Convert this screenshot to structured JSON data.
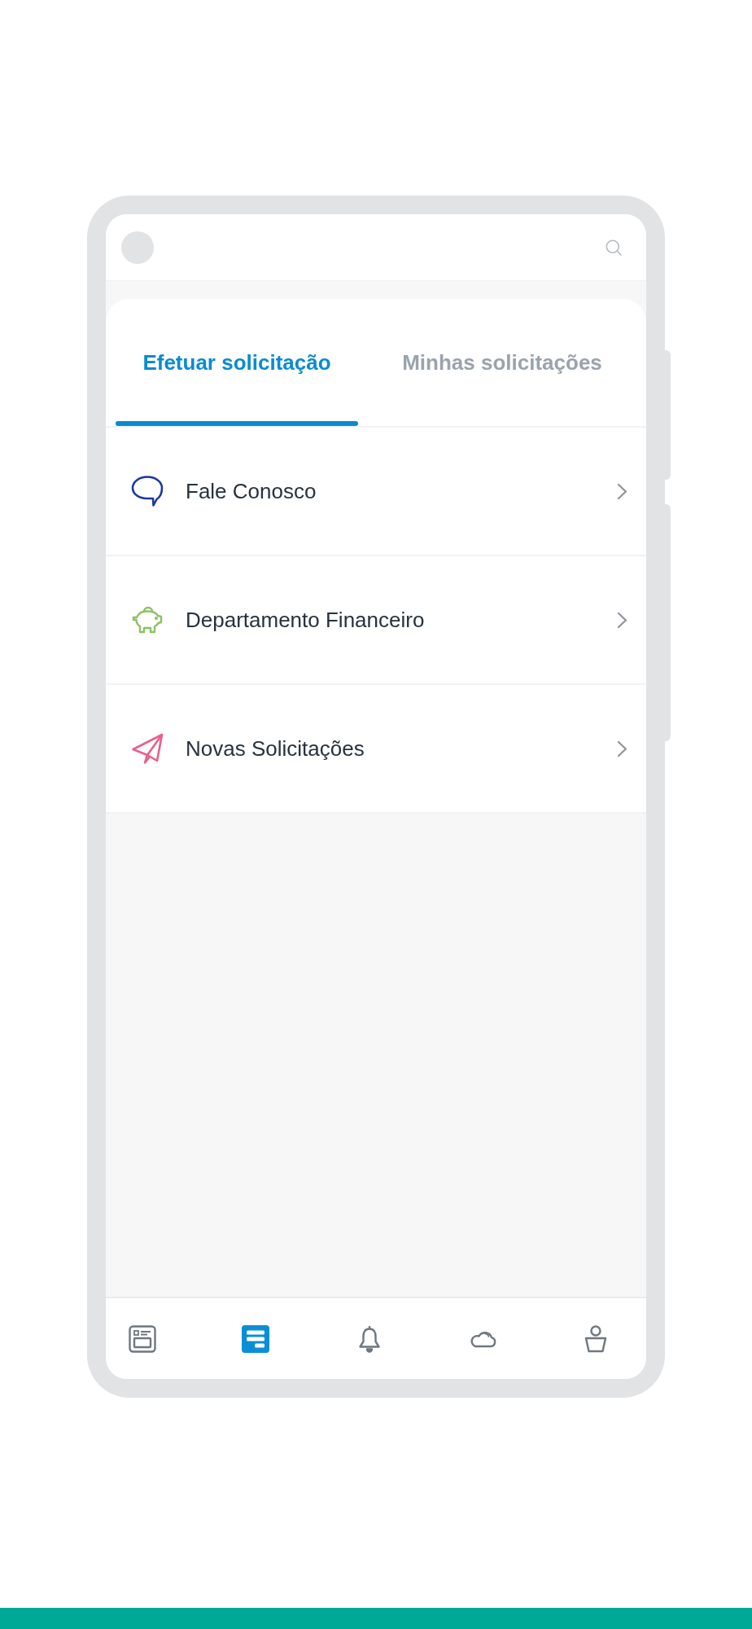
{
  "tabs": [
    {
      "label": "Efetuar solicitação",
      "selected": true
    },
    {
      "label": "Minhas solicitações",
      "selected": false
    }
  ],
  "menu_items": [
    {
      "label": "Fale Conosco",
      "kind": "chat"
    },
    {
      "label": "Departamento Financeiro",
      "kind": "finance"
    },
    {
      "label": "Novas Solicitações",
      "kind": "send"
    }
  ],
  "bottom_nav": [
    {
      "kind": "news",
      "selected": false
    },
    {
      "kind": "requests",
      "selected": true
    },
    {
      "kind": "alerts",
      "selected": false
    },
    {
      "kind": "cloud",
      "selected": false
    },
    {
      "kind": "profile",
      "selected": false
    }
  ]
}
